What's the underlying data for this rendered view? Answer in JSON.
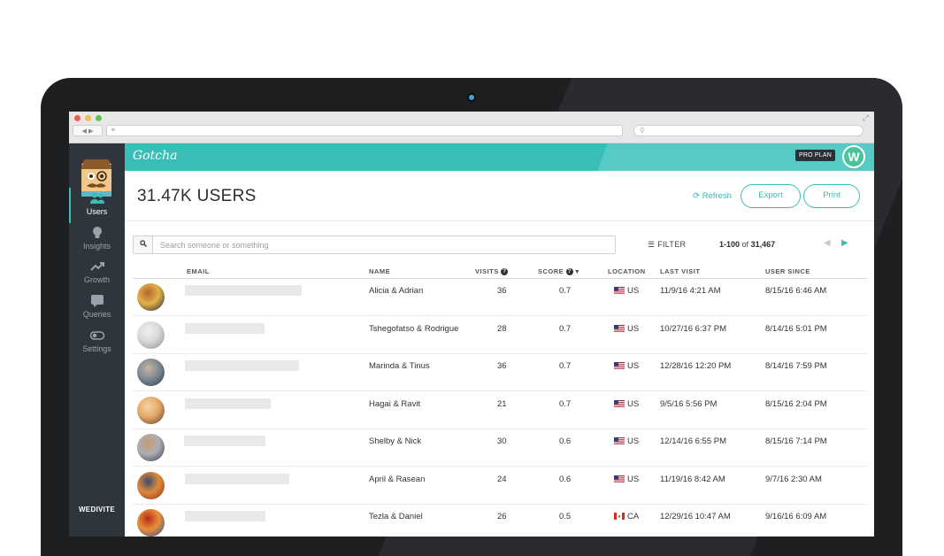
{
  "browser": {
    "nav_label": "◀ ▶",
    "new_tab": "+",
    "search_icon": "search-icon"
  },
  "sidebar": {
    "items": [
      {
        "label": "Users",
        "icon": "users-icon",
        "active": true
      },
      {
        "label": "Insights",
        "icon": "lightbulb-icon",
        "active": false
      },
      {
        "label": "Growth",
        "icon": "trend-up-icon",
        "active": false
      },
      {
        "label": "Queries",
        "icon": "chat-bubble-icon",
        "active": false
      },
      {
        "label": "Settings",
        "icon": "toggle-icon",
        "active": false
      }
    ],
    "brand": "WEDIVITE"
  },
  "topbar": {
    "logo": "Gotcha",
    "plan_badge": "PRO PLAN",
    "account_initial": "W"
  },
  "header": {
    "title": "31.47K USERS",
    "refresh_label": "Refresh",
    "export_label": "Export",
    "print_label": "Print"
  },
  "toolbar": {
    "search_placeholder": "Search someone or something",
    "filter_label": "FILTER",
    "range": "1-100",
    "of_label": "of",
    "total": "31,467"
  },
  "table": {
    "columns": {
      "email": "EMAIL",
      "name": "NAME",
      "visits": "VISITS",
      "score": "SCORE",
      "location": "LOCATION",
      "last_visit": "LAST VISIT",
      "user_since": "USER SINCE"
    },
    "rows": [
      {
        "name": "Alicia & Adrian",
        "visits": "36",
        "score": "0.7",
        "location": "US",
        "last_visit": "11/9/16 4:21 AM",
        "user_since": "8/15/16 6:46 AM"
      },
      {
        "name": "Tshegofatso & Rodrigue",
        "visits": "28",
        "score": "0.7",
        "location": "US",
        "last_visit": "10/27/16 6:37 PM",
        "user_since": "8/14/16 5:01 PM"
      },
      {
        "name": "Marinda & Tinus",
        "visits": "36",
        "score": "0.7",
        "location": "US",
        "last_visit": "12/28/16 12:20 PM",
        "user_since": "8/14/16 7:59 PM"
      },
      {
        "name": "Hagai & Ravit",
        "visits": "21",
        "score": "0.7",
        "location": "US",
        "last_visit": "9/5/16 5:56 PM",
        "user_since": "8/15/16 2:04 PM"
      },
      {
        "name": "Shelby & Nick",
        "visits": "30",
        "score": "0.6",
        "location": "US",
        "last_visit": "12/14/16 6:55 PM",
        "user_since": "8/15/16 7:14 PM"
      },
      {
        "name": "April & Rasean",
        "visits": "24",
        "score": "0.6",
        "location": "US",
        "last_visit": "11/19/16 8:42 AM",
        "user_since": "9/7/16 2:30 AM"
      },
      {
        "name": "Tezla & Daniel",
        "visits": "26",
        "score": "0.5",
        "location": "CA",
        "last_visit": "12/29/16 10:47 AM",
        "user_since": "9/16/16 6:09 AM"
      }
    ]
  },
  "colors": {
    "accent": "#3bbdb7",
    "sidebar": "#2f353c",
    "topbar": "#3bbdb7"
  }
}
